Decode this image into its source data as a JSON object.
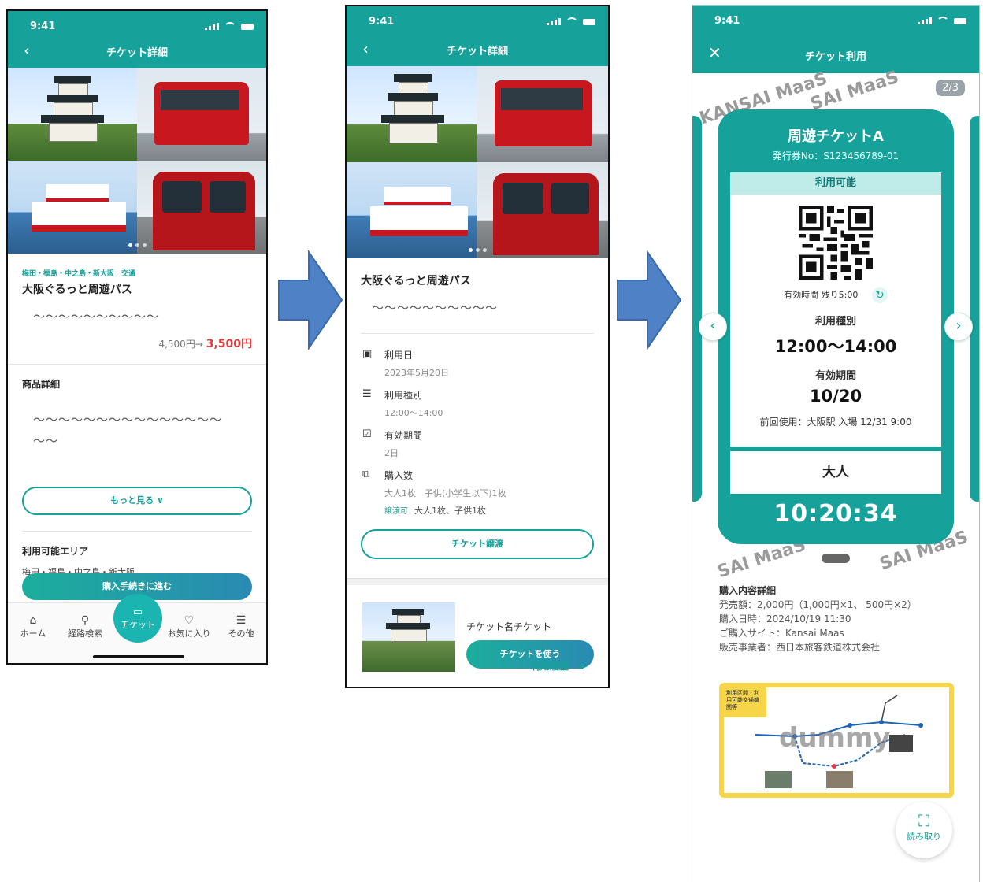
{
  "status": {
    "time": "9:41"
  },
  "phone1": {
    "nav_title": "チケット詳細",
    "tag": "梅田・福島・中之島・新大阪　交通",
    "title": "大阪ぐるっと周遊パス",
    "placeholder_text": "～～～～～～～～～～",
    "old_price": "4,500円→",
    "new_price": "3,500円",
    "detail_heading": "商品詳細",
    "detail_text_1": "～～～～～～～～～～～～～～～",
    "detail_text_2": "～～",
    "more_button": "もっと見る ∨",
    "area_heading": "利用可能エリア",
    "area_value": "梅田・福島・中之島・新大阪",
    "purchase_button": "購入手続きに進む",
    "tabs": {
      "home": "ホーム",
      "route": "経路検索",
      "ticket": "チケット",
      "favorite": "お気に入り",
      "other": "その他"
    }
  },
  "phone2": {
    "nav_title": "チケット詳細",
    "title": "大阪ぐるっと周遊パス",
    "placeholder_text": "～～～～～～～～～～",
    "date_label": "利用日",
    "date_value": "2023年5月20日",
    "type_label": "利用種別",
    "type_value": "12:00〜14:00",
    "period_label": "有効期間",
    "period_value": "2日",
    "qty_label": "購入数",
    "qty_value": "大人1枚　子供(小学生以下)1枚",
    "transfer_tag": "譲渡可",
    "transfer_value": "大人1枚、子供1枚",
    "transfer_button": "チケット譲渡",
    "ticket_name": "チケット名チケット",
    "use_button": "チケットを使う",
    "history_link": "利用履歴"
  },
  "phone3": {
    "nav_title": "チケット利用",
    "watermark": "KANSAI MaaS",
    "watermark_short": "SAI MaaS",
    "page_indicator": "2/3",
    "ticket_title": "周遊チケットA",
    "issue_no": "発行券No：S123456789-01",
    "status": "利用可能",
    "valid_time": "有効時間 残り5:00",
    "type_label": "利用種別",
    "type_value": "12:00〜14:00",
    "period_label": "有効期間",
    "period_value": "10/20",
    "last_use": "前回使用：大阪駅 入場 12/31 9:00",
    "person": "大人",
    "clock": "10:20:34",
    "purchase_heading": "購入内容詳細",
    "purchase_lines": [
      "発売額：2,000円（1,000円×1、 500円×2）",
      "購入日時：2024/10/19 11:30",
      "ご購入サイト：Kansai Maas",
      "販売事業者：西日本旅客鉄道株式会社"
    ],
    "map_caption": "利用区間・利用可能交通機関等",
    "map_watermark": "dummy",
    "scan_label": "読み取り"
  },
  "colors": {
    "accent": "#16a19b",
    "price": "#e23b3b",
    "flow_arrow": "#4f81c7"
  },
  "icons": [
    "back-icon",
    "close-icon",
    "calendar-icon",
    "list-icon",
    "period-icon",
    "ticket-stack-icon",
    "chevron-down-icon",
    "refresh-icon",
    "scan-icon",
    "home-icon",
    "route-icon",
    "ticket-icon",
    "heart-icon",
    "menu-icon"
  ]
}
